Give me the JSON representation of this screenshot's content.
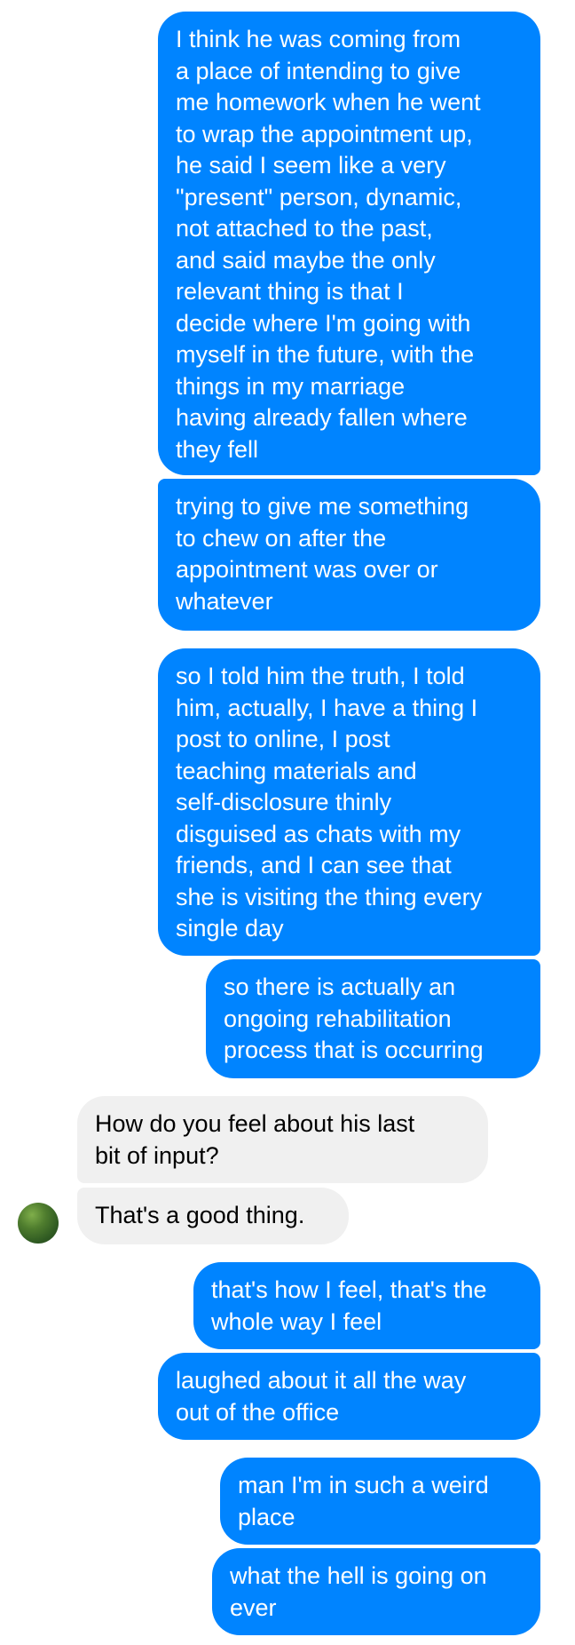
{
  "chat": {
    "messages": [
      {
        "sender": "me",
        "text": "I think he was coming from\na place of intending to give\nme homework when he went\nto wrap the appointment up,\nhe said I seem like a very\n\"present\" person, dynamic,\nnot attached to the past,\nand said maybe the only\nrelevant thing is that I\ndecide where I'm going with\nmyself in the future, with the\nthings in my marriage\nhaving already fallen where\nthey fell"
      },
      {
        "sender": "me",
        "text": "trying to give me something\nto chew on after the\nappointment was over or\nwhatever"
      },
      {
        "sender": "me",
        "text": "so I told him the truth, I told\nhim, actually, I have a thing I\npost to online, I post\nteaching materials and\nself-disclosure thinly\ndisguised as chats with my\nfriends, and I can see that\nshe is visiting the thing every\nsingle day"
      },
      {
        "sender": "me",
        "text": "so there is actually an\nongoing rehabilitation\nprocess that is occurring"
      },
      {
        "sender": "them",
        "text": "How do you feel about his last\nbit of input?"
      },
      {
        "sender": "them",
        "text": "That's a good thing."
      },
      {
        "sender": "me",
        "text": "that's how I feel, that's the\nwhole way I feel"
      },
      {
        "sender": "me",
        "text": "laughed about it all the way\nout of the office"
      },
      {
        "sender": "me",
        "text": "man I'm in such a weird\nplace"
      },
      {
        "sender": "me",
        "text": "what the hell is going on\never"
      }
    ],
    "contact_avatar_icon": "contact-avatar-icon",
    "colors": {
      "outgoing_bubble": "#0084ff",
      "outgoing_text": "#ffffff",
      "incoming_bubble": "#f0f0f0",
      "incoming_text": "#000000",
      "background": "#ffffff"
    }
  }
}
